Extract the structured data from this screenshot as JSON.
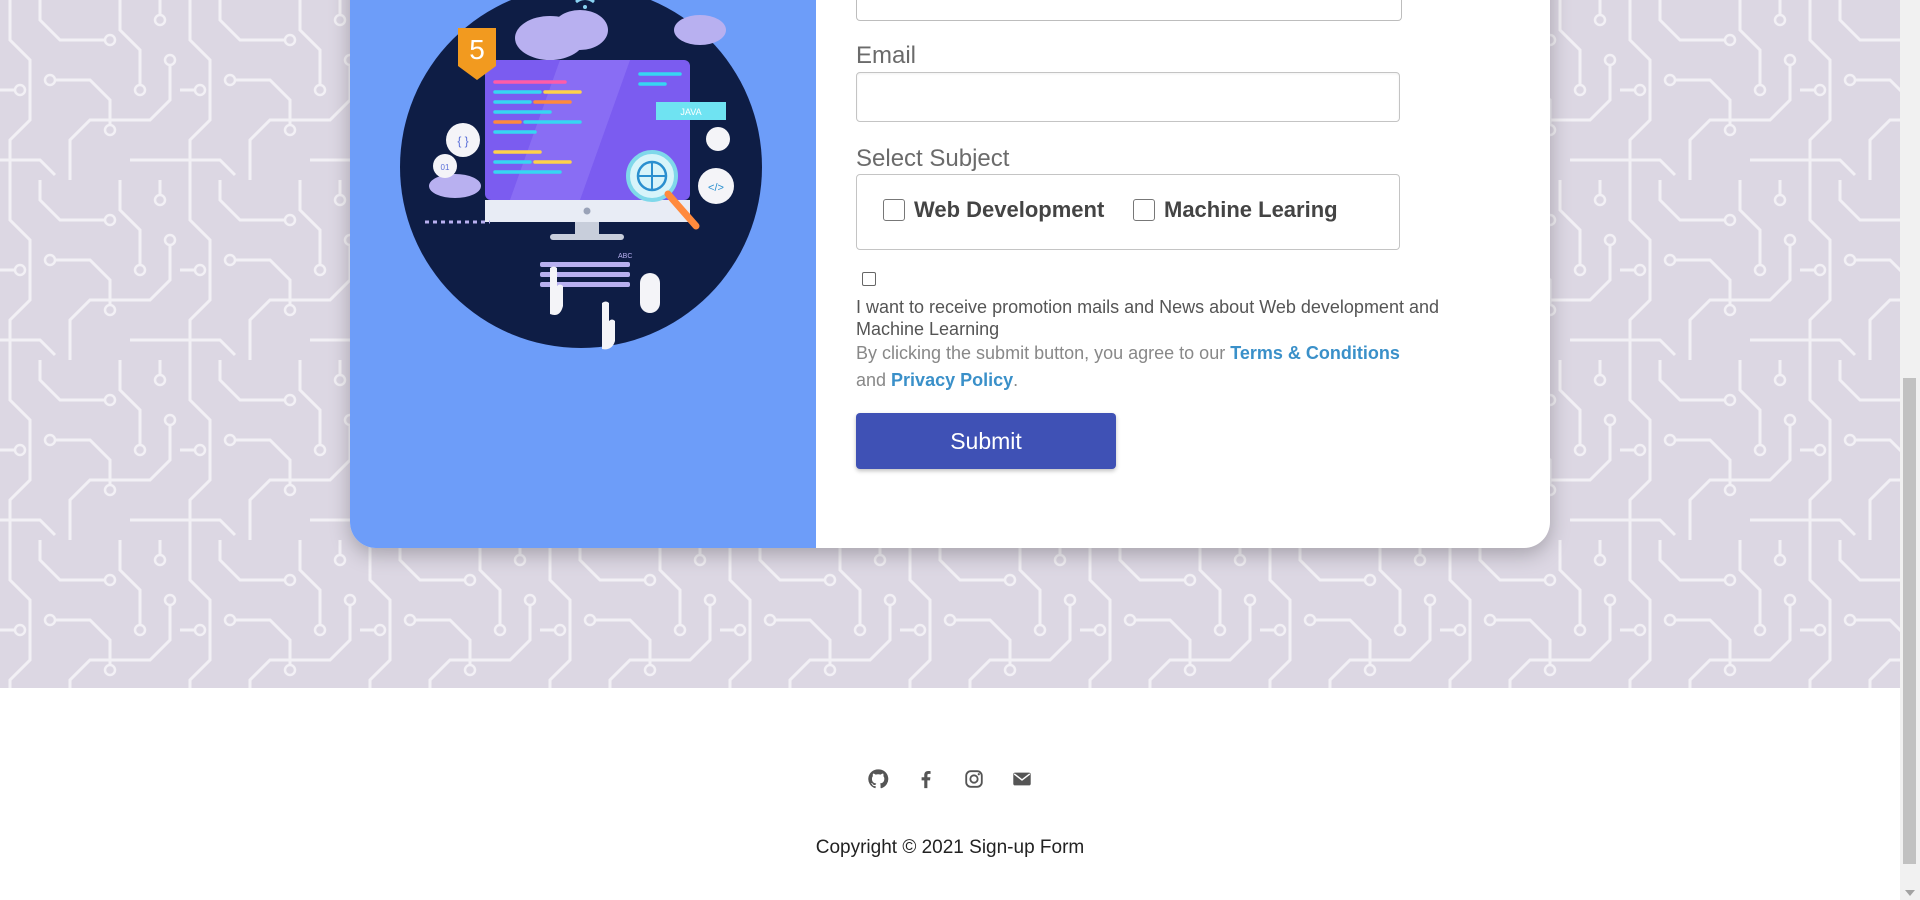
{
  "form": {
    "email_label": "Email",
    "email_value": "",
    "subject_label": "Select Subject",
    "subjects": [
      {
        "label": "Web Development",
        "checked": false
      },
      {
        "label": "Machine Learing",
        "checked": false
      }
    ],
    "promo_text": "I want to receive promotion mails and News about Web development and Machine Learning",
    "terms_prefix": "By clicking the submit button, you agree to our ",
    "terms_link": "Terms & Conditions",
    "terms_and": "and ",
    "privacy_link": "Privacy Policy",
    "terms_suffix": ".",
    "submit_label": "Submit"
  },
  "illustration": {
    "badge_number": "5",
    "tag_java": "JAVA",
    "tag_abc": "ABC",
    "braces": "{ }",
    "binary": "01",
    "code_tag": "</>"
  },
  "footer": {
    "icons": [
      "github-icon",
      "facebook-icon",
      "instagram-icon",
      "email-icon"
    ],
    "copyright": "Copyright © 2021 Sign-up Form"
  },
  "colors": {
    "left_panel": "#6d9df9",
    "submit": "#3f51b5",
    "link": "#3a90c9",
    "background": "#dcd7e3"
  }
}
